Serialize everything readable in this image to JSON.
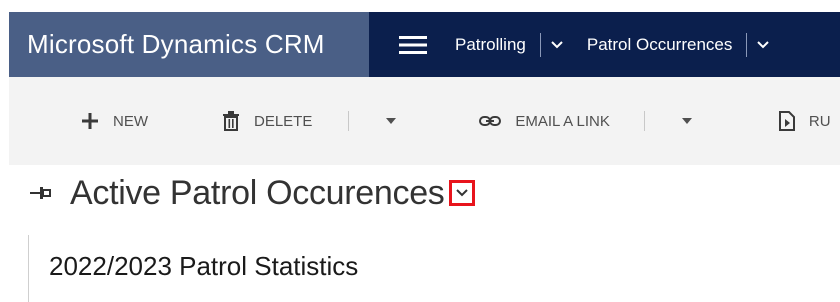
{
  "header": {
    "app_title": "Microsoft Dynamics CRM",
    "nav": [
      {
        "label": "Patrolling"
      },
      {
        "label": "Patrol Occurrences"
      }
    ]
  },
  "commands": {
    "new_label": "NEW",
    "delete_label": "DELETE",
    "email_label": "EMAIL A LINK",
    "run_label": "RU"
  },
  "view": {
    "title": "Active Patrol Occurences",
    "highlight_color": "#e8141c"
  },
  "chart": {
    "title": "2022/2023 Patrol Statistics"
  },
  "colors": {
    "nav_bg": "#0b1f4d",
    "brand_bg": "#4a5f86",
    "command_bar_bg": "#f3f3f3"
  },
  "icons": [
    "hamburger-icon",
    "chevron-down-icon",
    "plus-icon",
    "trash-icon",
    "link-icon",
    "run-report-icon",
    "pin-icon"
  ]
}
